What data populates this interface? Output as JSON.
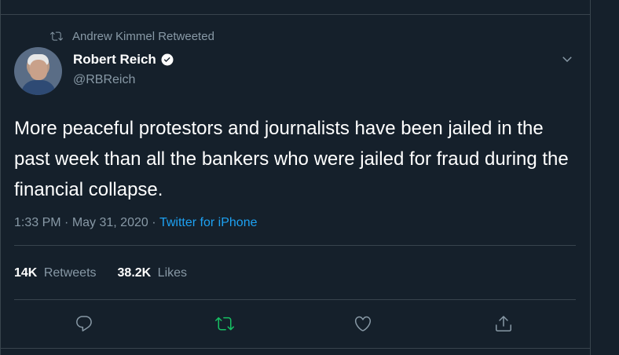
{
  "retweet": {
    "text": "Andrew Kimmel Retweeted",
    "icon": "retweet-icon"
  },
  "author": {
    "display_name": "Robert Reich",
    "handle": "@RBReich",
    "verified": true
  },
  "tweet": {
    "text": "More peaceful protestors and journalists have been jailed in the past week than all the bankers who were jailed for fraud during the financial collapse.",
    "time": "1:33 PM",
    "separator1": " · ",
    "date": "May 31, 2020",
    "separator2": " · ",
    "source": "Twitter for iPhone"
  },
  "stats": {
    "retweets_count": "14K",
    "retweets_label": "Retweets",
    "likes_count": "38.2K",
    "likes_label": "Likes"
  },
  "actions": [
    "reply-icon",
    "retweet-icon",
    "like-icon",
    "share-icon"
  ],
  "colors": {
    "background": "#15202b",
    "muted": "#8899a6",
    "accent": "#1da1f2",
    "retweeted_green": "#17bf63",
    "divider": "#38444d"
  }
}
